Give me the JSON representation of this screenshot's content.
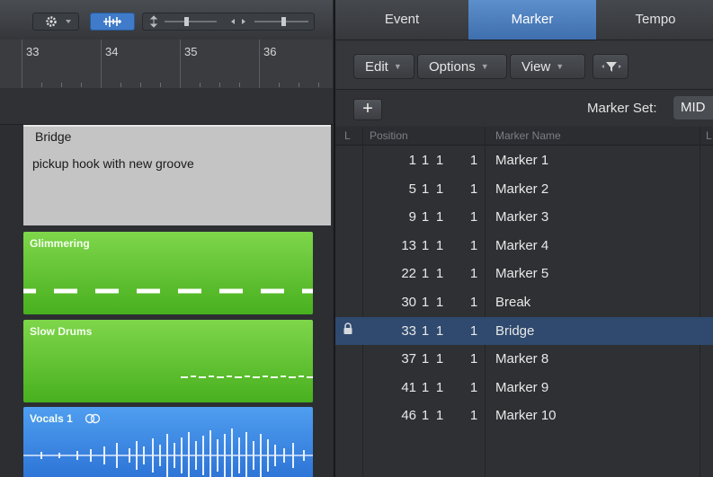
{
  "left": {
    "ruler": {
      "bars": [
        "33",
        "34",
        "35",
        "36"
      ]
    },
    "marker_region": {
      "title": "Bridge",
      "text": "pickup hook with new groove"
    },
    "tracks": [
      {
        "name": "Glimmering",
        "color": "#5cc22e"
      },
      {
        "name": "Slow Drums",
        "color": "#5cc22e"
      },
      {
        "name": "Vocals 1",
        "color": "#3a86e3"
      }
    ]
  },
  "right": {
    "tabs": [
      {
        "label": "Event",
        "active": false
      },
      {
        "label": "Marker",
        "active": true
      },
      {
        "label": "Tempo",
        "active": false
      }
    ],
    "menu": {
      "edit": "Edit",
      "options": "Options",
      "view": "View"
    },
    "add_label": "+",
    "marker_set": {
      "label": "Marker Set:",
      "value": "MID"
    },
    "columns": {
      "lock": "L",
      "position": "Position",
      "name": "Marker Name",
      "length": "L"
    },
    "markers": [
      {
        "bar": "1",
        "beat": "1",
        "div": "1",
        "tick": "1",
        "name": "Marker 1",
        "locked": false,
        "selected": false
      },
      {
        "bar": "5",
        "beat": "1",
        "div": "1",
        "tick": "1",
        "name": "Marker 2",
        "locked": false,
        "selected": false
      },
      {
        "bar": "9",
        "beat": "1",
        "div": "1",
        "tick": "1",
        "name": "Marker 3",
        "locked": false,
        "selected": false
      },
      {
        "bar": "13",
        "beat": "1",
        "div": "1",
        "tick": "1",
        "name": "Marker 4",
        "locked": false,
        "selected": false
      },
      {
        "bar": "22",
        "beat": "1",
        "div": "1",
        "tick": "1",
        "name": "Marker 5",
        "locked": false,
        "selected": false
      },
      {
        "bar": "30",
        "beat": "1",
        "div": "1",
        "tick": "1",
        "name": "Break",
        "locked": false,
        "selected": false
      },
      {
        "bar": "33",
        "beat": "1",
        "div": "1",
        "tick": "1",
        "name": "Bridge",
        "locked": true,
        "selected": true
      },
      {
        "bar": "37",
        "beat": "1",
        "div": "1",
        "tick": "1",
        "name": "Marker 8",
        "locked": false,
        "selected": false
      },
      {
        "bar": "41",
        "beat": "1",
        "div": "1",
        "tick": "1",
        "name": "Marker 9",
        "locked": false,
        "selected": false
      },
      {
        "bar": "46",
        "beat": "1",
        "div": "1",
        "tick": "1",
        "name": "Marker 10",
        "locked": false,
        "selected": false
      }
    ]
  }
}
